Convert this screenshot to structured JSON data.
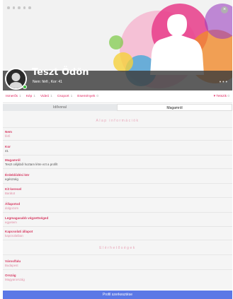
{
  "profile": {
    "name": "Teszt Ödön",
    "meta": "Nem: férfi , Kor: 41",
    "menu": "• • •"
  },
  "tabs": [
    {
      "label": "Ismerős",
      "count": "1"
    },
    {
      "label": "Kép",
      "count": "1"
    },
    {
      "label": "Videó",
      "count": "1"
    },
    {
      "label": "Csoport",
      "count": "1"
    },
    {
      "label": "Események",
      "count": "0"
    }
  ],
  "tab_right": {
    "label": "▾ Tetszik",
    "count": "0"
  },
  "subtabs": {
    "inactive": "Idővonal",
    "active": "Magamról"
  },
  "sections": {
    "basic": "Alap információk",
    "contact": "Elérhetőségek"
  },
  "fields": {
    "nem": {
      "label": "Nem",
      "value": "férfi"
    },
    "kor": {
      "label": "Kor",
      "value": "41"
    },
    "magamrol": {
      "label": "Magamról",
      "value": "Teszt céljából hoztam létre ezt a profilt"
    },
    "erdeklodesi": {
      "label": "Érdeklődési kör",
      "value": "egészség"
    },
    "kit_keresel": {
      "label": "Kit keresel",
      "value": "Barátot"
    },
    "allapotod": {
      "label": "Állapotod",
      "value": "dolgozom"
    },
    "vegzettseg": {
      "label": "Legmagasabb végzettséged",
      "value": "egyetem"
    },
    "kapcsolati": {
      "label": "Kapcsolati állapot",
      "value": "kapcsolatban"
    },
    "varos": {
      "label": "Város/falu",
      "value": "Budapest"
    },
    "orszag": {
      "label": "Ország",
      "value": "Magyarország"
    }
  },
  "buttons": {
    "edit": "Profil szerkesztése",
    "close": "×"
  }
}
